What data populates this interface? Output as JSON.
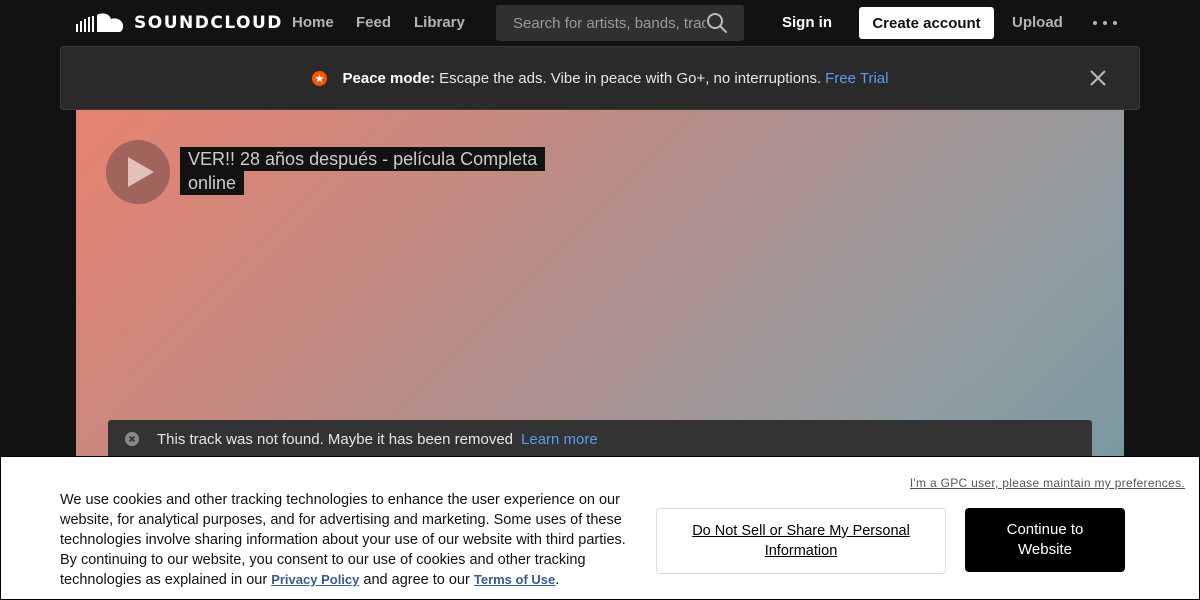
{
  "header": {
    "logo_text": "SOUNDCLOUD",
    "nav": [
      "Home",
      "Feed",
      "Library"
    ],
    "search_placeholder": "Search for artists, bands, tracks, podcasts",
    "sign_in": "Sign in",
    "create_account": "Create account",
    "upload": "Upload"
  },
  "banner": {
    "title": "Peace mode:",
    "message": "Escape the ads. Vibe in peace with Go+, no interruptions.",
    "link": "Free Trial"
  },
  "track": {
    "title": "VER!! 28 años después - película Completa online",
    "not_found": "This track was not found. Maybe it has been removed",
    "learn_more": "Learn more"
  },
  "cookie": {
    "gpc_link": "I'm a GPC user, please maintain my preferences.",
    "text_before": "We use cookies and other tracking technologies to enhance the user experience on our website, for analytical purposes, and for advertising and marketing. Some uses of these technologies involve sharing information about your use of our website with third parties. By continuing to our website, you consent to our use of cookies and other tracking technologies as explained in our",
    "privacy_policy": "Privacy Policy",
    "text_middle": "and agree to our",
    "terms_of_use": "Terms of Use",
    "text_end": ".",
    "do_not_sell": "Do Not Sell or Share My Personal Information",
    "continue": "Continue to Website"
  },
  "colors": {
    "brand_orange": "#ff5500",
    "link_blue": "#5d9cec",
    "background": "#121212"
  },
  "icons": {
    "logo": "soundcloud-cloud-icon",
    "search": "search-icon",
    "more": "more-dots-icon",
    "banner": "star-icon",
    "close": "close-icon",
    "play": "play-icon",
    "error": "error-circle-icon"
  }
}
